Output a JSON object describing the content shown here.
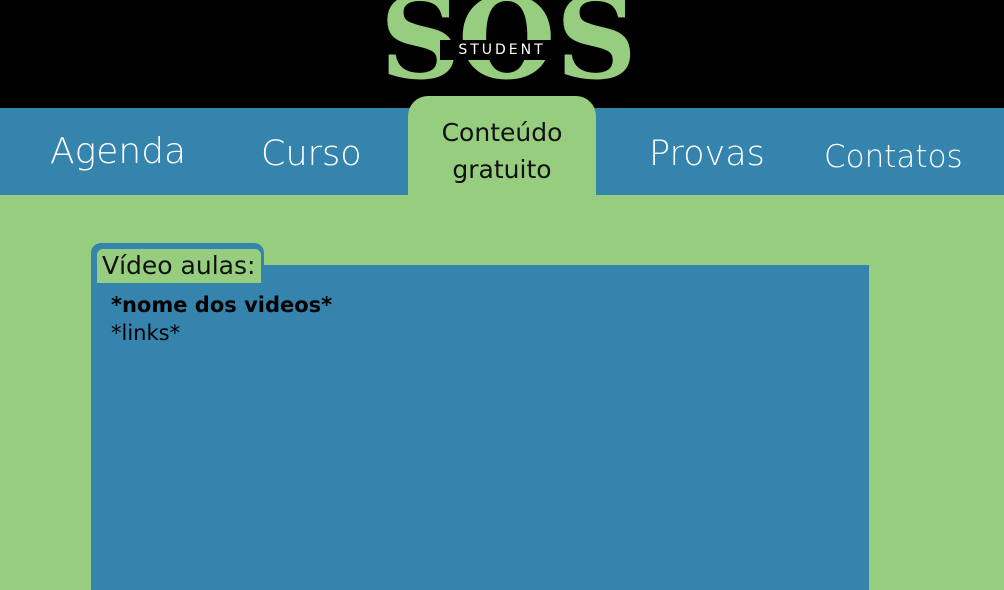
{
  "brand": {
    "letter_1": "S",
    "letter_2": "O",
    "letter_3": "S",
    "subtitle": "STUDENT",
    "color": "#97cd7e"
  },
  "nav": {
    "items": [
      {
        "label": "Agenda"
      },
      {
        "label": "Curso"
      },
      {
        "label": "Conteúdo",
        "label_line2": "gratuito",
        "active": true
      },
      {
        "label": "Provas"
      },
      {
        "label": "Contatos"
      }
    ],
    "background": "#3484ad",
    "active_background": "#97cd7e"
  },
  "panel": {
    "title": "Vídeo aulas:",
    "video_name": "*nome dos videos*",
    "links": "*links*",
    "background": "#3484ad"
  },
  "page": {
    "background": "#97cd7e",
    "header_background": "#000000"
  }
}
